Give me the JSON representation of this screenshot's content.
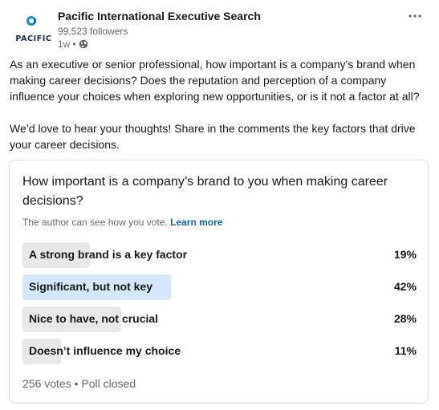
{
  "post": {
    "author": {
      "name": "Pacific International Executive Search",
      "followers": "99,523 followers",
      "time": "1w",
      "separator": "•",
      "logo_text": "PACIFIC",
      "logo_icon": "pacific-logo-icon",
      "visibility_icon": "globe-icon"
    },
    "more_icon": "ellipsis-icon",
    "paragraphs": [
      "As an executive or senior professional, how important is a company's brand when making career decisions? Does the reputation and perception of a company influence your choices when exploring new opportunities, or is it not a factor at all?",
      "We’d love to hear your thoughts! Share in the comments the key factors that drive your career decisions."
    ]
  },
  "poll": {
    "question": "How important is a company’s brand to you when making career decisions?",
    "note": "The author can see how you vote.",
    "learn_more": "Learn more",
    "options": [
      {
        "label": "A strong brand is a key factor",
        "percent": "19%",
        "value": 19
      },
      {
        "label": "Significant, but not key",
        "percent": "42%",
        "value": 42
      },
      {
        "label": "Nice to have, not crucial",
        "percent": "28%",
        "value": 28
      },
      {
        "label": "Doesn’t influence my choice",
        "percent": "11%",
        "value": 11
      }
    ],
    "votes": "256 votes",
    "separator": "•",
    "status": "Poll closed"
  },
  "colors": {
    "link": "#0a66c2",
    "bar_default": "#e8e8e8",
    "bar_winner": "#d5e7fb"
  }
}
